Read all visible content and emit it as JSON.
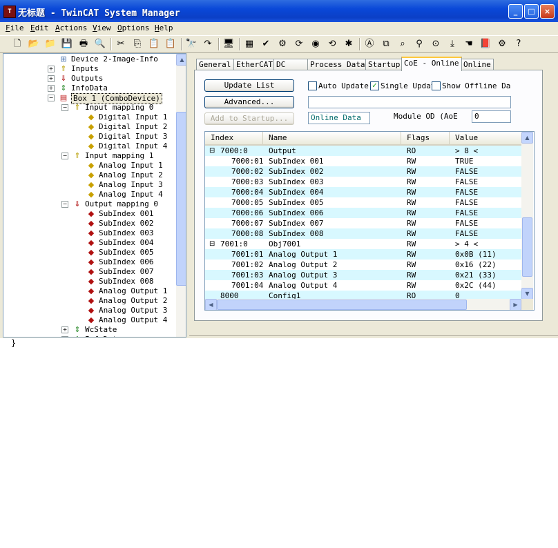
{
  "window": {
    "title": "无标题 - TwinCAT System Manager",
    "buttons": {
      "minimize": "_",
      "maximize": "□",
      "close": "×"
    }
  },
  "menu": [
    {
      "label": "File",
      "key": "F",
      "rest": "ile"
    },
    {
      "label": "Edit",
      "key": "E",
      "rest": "dit"
    },
    {
      "label": "Actions",
      "key": "A",
      "rest": "ctions"
    },
    {
      "label": "View",
      "key": "V",
      "rest": "iew"
    },
    {
      "label": "Options",
      "key": "O",
      "rest": "ptions"
    },
    {
      "label": "Help",
      "key": "H",
      "rest": "elp"
    }
  ],
  "toolbar_icons": [
    "new-icon",
    "open-icon",
    "open-folder-icon",
    "save-icon",
    "print-icon",
    "print-preview-icon",
    "cut-icon",
    "copy-icon",
    "paste-icon",
    "paste-with-links-icon",
    "find-icon",
    "find-next-icon",
    "target-system-icon",
    "generate-mappings-icon",
    "check-configuration-icon",
    "activate-configuration-icon",
    "restart-icon",
    "set-free-run-icon",
    "set-config-mode-icon",
    "scan-devices-icon",
    "toggle-online-icon",
    "show-variables-icon",
    "zoom-icon",
    "free-run-icon",
    "view-online-icon",
    "force-icon",
    "hand-icon",
    "book-icon",
    "settings-icon",
    "help-icon"
  ],
  "tree": [
    {
      "label": "Device 2-Image-Info",
      "icon": "image-info-icon"
    },
    {
      "label": "Inputs",
      "icon": "inputs-icon"
    },
    {
      "label": "Outputs",
      "icon": "outputs-icon"
    },
    {
      "label": "InfoData",
      "icon": "infodata-icon"
    },
    {
      "label": "Box 1 (ComboDevice)",
      "icon": "box-icon",
      "selected": true
    },
    {
      "label": "Input mapping 0",
      "icon": "input-mapping-icon"
    },
    {
      "label": "Digital Input 1",
      "icon": "input-var-icon"
    },
    {
      "label": "Digital Input 2",
      "icon": "input-var-icon"
    },
    {
      "label": "Digital Input 3",
      "icon": "input-var-icon"
    },
    {
      "label": "Digital Input 4",
      "icon": "input-var-icon"
    },
    {
      "label": "Input mapping 1",
      "icon": "input-mapping-icon"
    },
    {
      "label": "Analog Input 1",
      "icon": "input-var-icon"
    },
    {
      "label": "Analog Input 2",
      "icon": "input-var-icon"
    },
    {
      "label": "Analog Input 3",
      "icon": "input-var-icon"
    },
    {
      "label": "Analog Input 4",
      "icon": "input-var-icon"
    },
    {
      "label": "Output mapping 0",
      "icon": "output-mapping-icon"
    },
    {
      "label": "SubIndex 001",
      "icon": "output-var-icon"
    },
    {
      "label": "SubIndex 002",
      "icon": "output-var-icon"
    },
    {
      "label": "SubIndex 003",
      "icon": "output-var-icon"
    },
    {
      "label": "SubIndex 004",
      "icon": "output-var-icon"
    },
    {
      "label": "SubIndex 005",
      "icon": "output-var-icon"
    },
    {
      "label": "SubIndex 006",
      "icon": "output-var-icon"
    },
    {
      "label": "SubIndex 007",
      "icon": "output-var-icon"
    },
    {
      "label": "SubIndex 008",
      "icon": "output-var-icon"
    },
    {
      "label": "Analog Output 1",
      "icon": "output-var-icon"
    },
    {
      "label": "Analog Output 2",
      "icon": "output-var-icon"
    },
    {
      "label": "Analog Output 3",
      "icon": "output-var-icon"
    },
    {
      "label": "Analog Output 4",
      "icon": "output-var-icon"
    },
    {
      "label": "WcState",
      "icon": "wcstate-icon"
    },
    {
      "label": "InfoData",
      "icon": "infodata-icon"
    }
  ],
  "tabs": [
    "General",
    "EtherCAT",
    "DC",
    "Process Data",
    "Startup",
    "CoE - Online",
    "Online"
  ],
  "active_tab": "CoE - Online",
  "coe": {
    "update_list": "Update List",
    "advanced": "Advanced...",
    "add_to_startup": "Add to Startup...",
    "auto_update": "Auto Update",
    "single_update": "Single Updat",
    "show_offline": "Show Offline Da",
    "auto_update_checked": false,
    "single_update_checked": true,
    "show_offline_checked": false,
    "search_value": "",
    "online_data": "Online Data",
    "module_od_label": "Module OD (AoE",
    "module_od_value": "0"
  },
  "list": {
    "columns": [
      "Index",
      "Name",
      "Flags",
      "Value"
    ],
    "rows": [
      {
        "index": "7000:0",
        "name": "Output",
        "flags": "RO",
        "value": "> 8 <",
        "group": true,
        "expander": "⊟"
      },
      {
        "index": "7000:01",
        "name": "SubIndex 001",
        "flags": "RW",
        "value": "TRUE"
      },
      {
        "index": "7000:02",
        "name": "SubIndex 002",
        "flags": "RW",
        "value": "FALSE"
      },
      {
        "index": "7000:03",
        "name": "SubIndex 003",
        "flags": "RW",
        "value": "FALSE"
      },
      {
        "index": "7000:04",
        "name": "SubIndex 004",
        "flags": "RW",
        "value": "FALSE"
      },
      {
        "index": "7000:05",
        "name": "SubIndex 005",
        "flags": "RW",
        "value": "FALSE"
      },
      {
        "index": "7000:06",
        "name": "SubIndex 006",
        "flags": "RW",
        "value": "FALSE"
      },
      {
        "index": "7000:07",
        "name": "SubIndex 007",
        "flags": "RW",
        "value": "FALSE"
      },
      {
        "index": "7000:08",
        "name": "SubIndex 008",
        "flags": "RW",
        "value": "FALSE"
      },
      {
        "index": "7001:0",
        "name": "Obj7001",
        "flags": "RW",
        "value": "> 4 <",
        "group": true,
        "expander": "⊟"
      },
      {
        "index": "7001:01",
        "name": "Analog Output 1",
        "flags": "RW",
        "value": "0x0B (11)"
      },
      {
        "index": "7001:02",
        "name": "Analog Output 2",
        "flags": "RW",
        "value": "0x16 (22)"
      },
      {
        "index": "7001:03",
        "name": "Analog Output 3",
        "flags": "RW",
        "value": "0x21 (33)"
      },
      {
        "index": "7001:04",
        "name": "Analog Output 4",
        "flags": "RW",
        "value": "0x2C (44)"
      },
      {
        "index": "8000",
        "name": "Config1",
        "flags": "RO",
        "value": "0",
        "group": true,
        "expander": ""
      }
    ]
  },
  "footer_text": "}"
}
